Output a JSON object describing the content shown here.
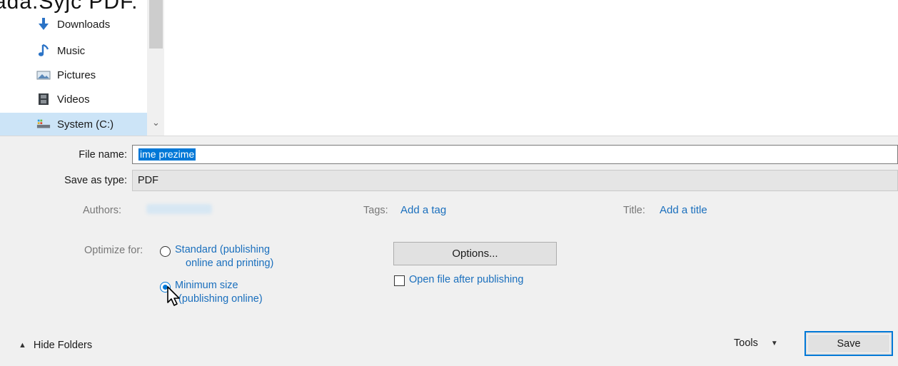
{
  "window": {
    "title_fragment": "ada.Syjc PDF."
  },
  "nav": {
    "items": [
      {
        "label": "Downloads",
        "icon": "download-arrow-icon"
      },
      {
        "label": "Music",
        "icon": "music-note-icon"
      },
      {
        "label": "Pictures",
        "icon": "pictures-icon"
      },
      {
        "label": "Videos",
        "icon": "film-icon"
      },
      {
        "label": "System (C:)",
        "icon": "drive-icon",
        "selected": true
      }
    ]
  },
  "form": {
    "file_name_label": "File name:",
    "file_name_value": "ime prezime",
    "save_type_label": "Save as type:",
    "save_type_value": "PDF",
    "authors_label": "Authors:",
    "tags_label": "Tags:",
    "tags_link": "Add a tag",
    "title_label": "Title:",
    "title_link": "Add a title",
    "optimize_label": "Optimize for:",
    "option_standard_line1": "Standard (publishing",
    "option_standard_line2": "online and printing)",
    "option_minimum_line1": "Minimum size",
    "option_minimum_line2": "(publishing online)",
    "selected_option": "minimum",
    "options_button": "Options...",
    "open_after_label": "Open file after publishing",
    "open_after_checked": false
  },
  "footer": {
    "hide_folders": "Hide Folders",
    "tools": "Tools",
    "save": "Save"
  },
  "colors": {
    "accent": "#0078d7",
    "link": "#1a6fbd",
    "panel": "#f0f0f0"
  }
}
